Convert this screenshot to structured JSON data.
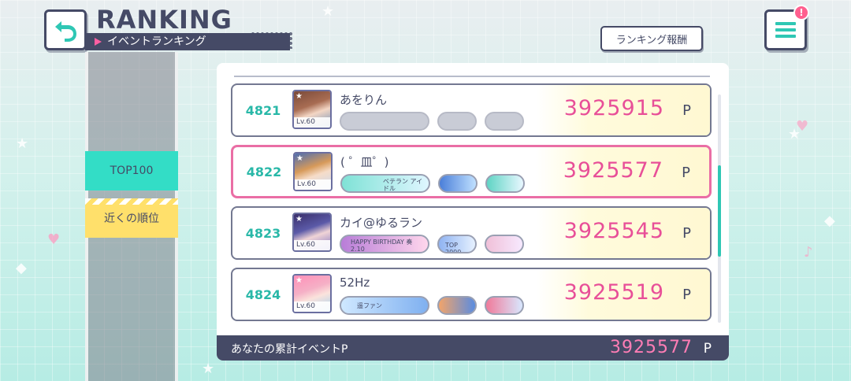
{
  "header": {
    "title": "RANKING",
    "subtitle": "イベントランキング",
    "reward_button": "ランキング報酬",
    "notification_badge": "!"
  },
  "side_tabs": [
    {
      "label": "TOP100",
      "color": "#33ddc6"
    },
    {
      "label": "近くの順位",
      "color": "#ffe06b"
    }
  ],
  "rankings": [
    {
      "rank": "4821",
      "name": "あをりん",
      "level": "Lv.60",
      "score": "3925915",
      "unit": "P",
      "highlighted": false,
      "badges": [
        "",
        "",
        ""
      ]
    },
    {
      "rank": "4822",
      "name": "( ゜皿゜)",
      "level": "Lv.60",
      "score": "3925577",
      "unit": "P",
      "highlighted": true,
      "badges": [
        "ベテラン アイドル",
        "",
        ""
      ]
    },
    {
      "rank": "4823",
      "name": "カイ@ゆるラン",
      "level": "Lv.60",
      "score": "3925545",
      "unit": "P",
      "highlighted": false,
      "badges": [
        "HAPPY BIRTHDAY 奏 2.10",
        "TOP 2000",
        ""
      ]
    },
    {
      "rank": "4824",
      "name": "52Hz",
      "level": "Lv.60",
      "score": "3925519",
      "unit": "P",
      "highlighted": false,
      "badges": [
        "遥ファン",
        "",
        ""
      ]
    }
  ],
  "footer": {
    "label": "あなたの累計イベントP",
    "score": "3925577",
    "unit": "P"
  },
  "colors": {
    "accent_pink": "#e84f98",
    "accent_teal": "#29b8a8",
    "navy": "#454a66"
  }
}
